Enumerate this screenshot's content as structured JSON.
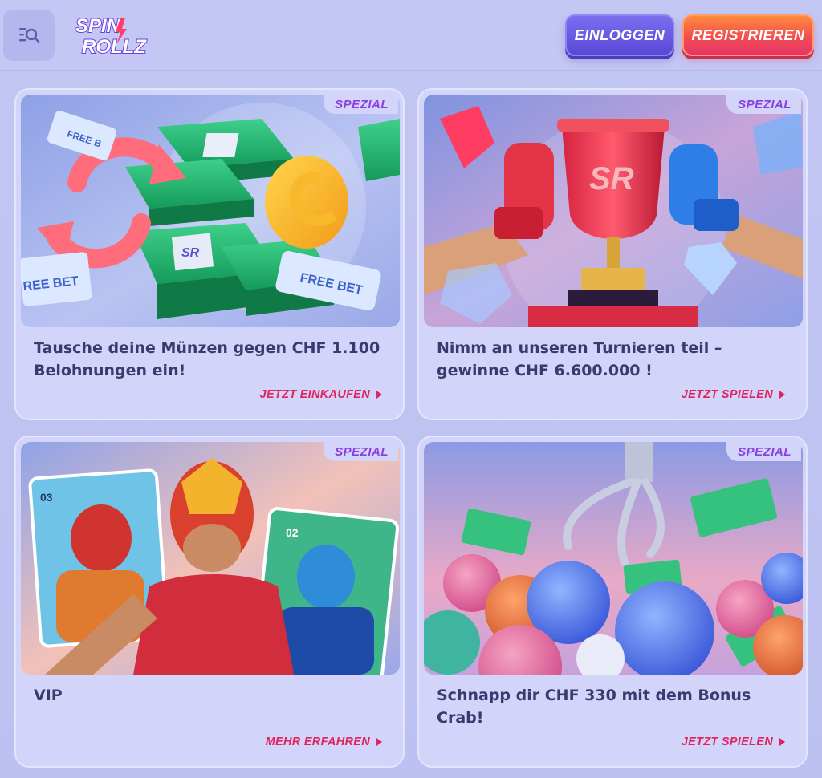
{
  "header": {
    "logo_line1": "SPIN",
    "logo_line2": "ROLLZ",
    "login_label": "EINLOGGEN",
    "register_label": "REGISTRIEREN",
    "menu_icon": "search-menu-icon"
  },
  "promos": [
    {
      "badge": "SPEZIAL",
      "title": "Tausche deine Münzen gegen CHF 1.100 Belohnungen ein!",
      "cta": "JETZT EINKAUFEN",
      "ticket_label": "FREE BET",
      "ticket_label_left": "REE BET",
      "ticket_label_top": "FREE B"
    },
    {
      "badge": "SPEZIAL",
      "title": "Nimm an unseren Turnieren teil – gewinne CHF 6.600.000 !",
      "cta": "JETZT SPIELEN",
      "trophy_label": "SR"
    },
    {
      "badge": "SPEZIAL",
      "title": "VIP",
      "cta": "MEHR ERFAHREN",
      "card_left_number": "03",
      "card_right_number": "02"
    },
    {
      "badge": "SPEZIAL",
      "title": "Schnapp dir CHF 330 mit dem Bonus Crab!",
      "cta": "JETZT SPIELEN"
    }
  ],
  "colors": {
    "accent_pink": "#e0245e",
    "badge_purple": "#8a3fe0",
    "title_text": "#3a3a6e"
  }
}
